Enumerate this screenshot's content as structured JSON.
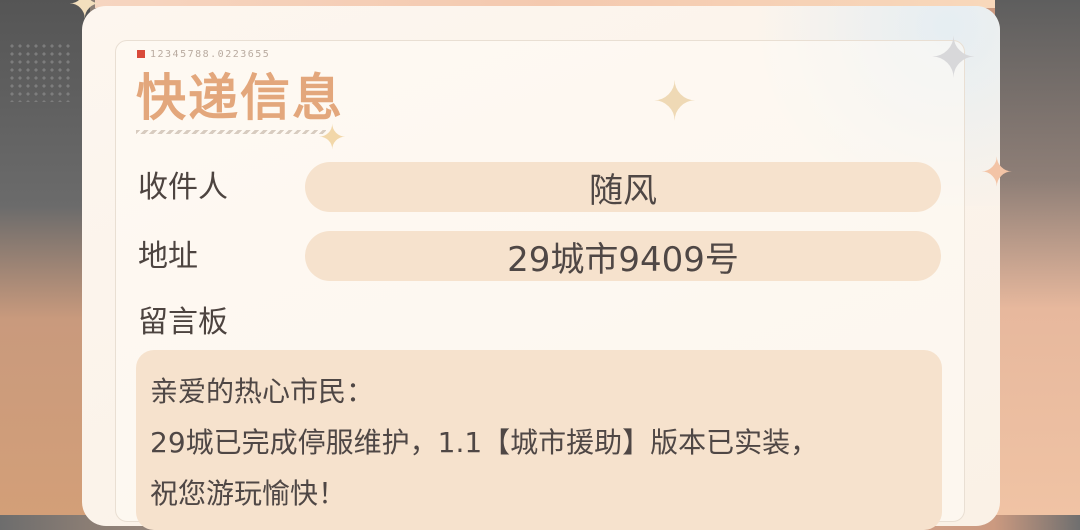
{
  "header": {
    "title": "快递信息",
    "serial": "12345788.0223655"
  },
  "fields": {
    "recipient": {
      "label": "收件人",
      "value": "随风"
    },
    "address": {
      "label": "地址",
      "value": "29城市9409号"
    }
  },
  "message": {
    "label": "留言板",
    "lines": [
      "亲爱的热心市民：",
      "29城已完成停服维护，1.1【城市援助】版本已实装，",
      "祝您游玩愉快！"
    ]
  },
  "decor": {
    "icons": [
      "sparkle-icon",
      "stamp-icon"
    ],
    "colors": {
      "title": "#e3a77c",
      "pill": "#f6e2cd",
      "text": "#4f4745"
    }
  }
}
